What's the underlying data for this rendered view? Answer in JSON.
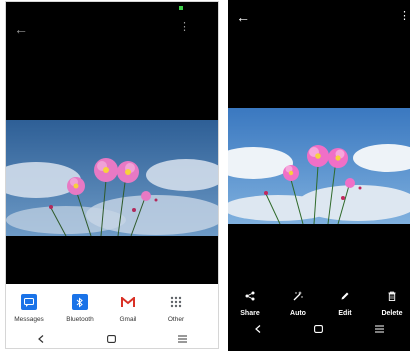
{
  "left_screen": {
    "share_targets": [
      {
        "label": "Messages",
        "icon": "messages-icon",
        "color": "#1a73e8"
      },
      {
        "label": "Bluetooth",
        "icon": "bluetooth-icon",
        "color": "#1a73e8"
      },
      {
        "label": "Gmail",
        "icon": "gmail-icon",
        "color": "#d93025"
      },
      {
        "label": "Other",
        "icon": "more-apps-icon",
        "color": "#5f6368"
      }
    ]
  },
  "right_screen": {
    "actions": [
      {
        "label": "Share",
        "icon": "share-icon"
      },
      {
        "label": "Auto",
        "icon": "auto-enhance-icon"
      },
      {
        "label": "Edit",
        "icon": "edit-icon"
      },
      {
        "label": "Delete",
        "icon": "delete-icon"
      }
    ]
  },
  "colors": {
    "accent_blue": "#1a73e8",
    "gmail_red": "#d93025",
    "status_green": "#3ecf4a",
    "background_dark": "#000000"
  }
}
